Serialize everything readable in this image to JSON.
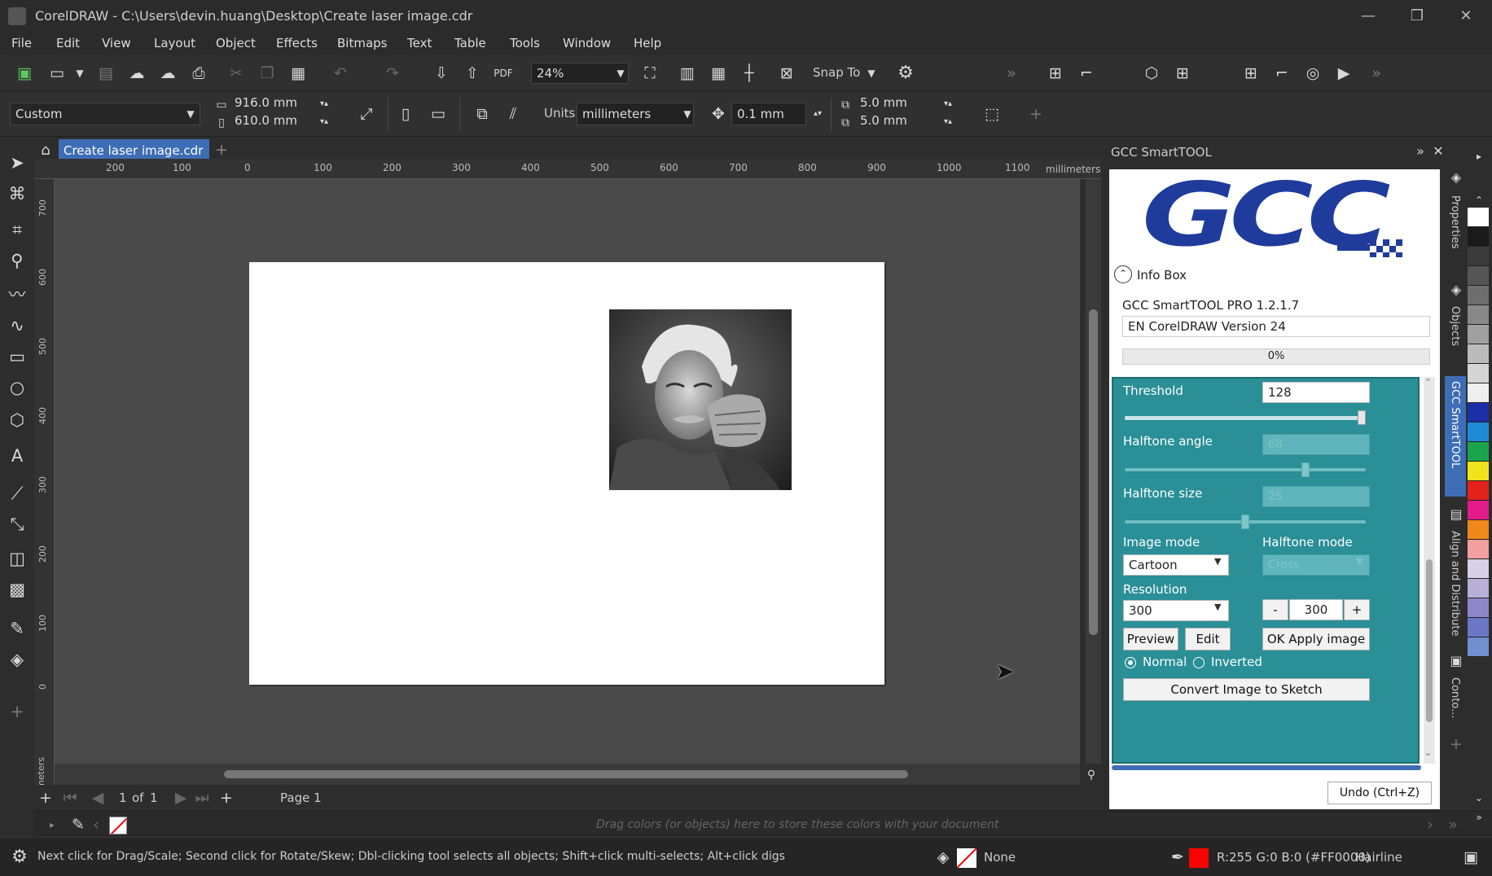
{
  "window": {
    "title": "CorelDRAW - C:\\Users\\devin.huang\\Desktop\\Create laser image.cdr",
    "minimize": "—",
    "restore": "❐",
    "close": "✕"
  },
  "menu": [
    "File",
    "Edit",
    "View",
    "Layout",
    "Object",
    "Effects",
    "Bitmaps",
    "Text",
    "Table",
    "Tools",
    "Window",
    "Help"
  ],
  "toolbar": {
    "zoom": "24%",
    "snap_to": "Snap To",
    "pdf_label": "PDF"
  },
  "property_bar": {
    "page_preset": "Custom",
    "width": "916.0 mm",
    "height": "610.0 mm",
    "units_label": "Units:",
    "units_value": "millimeters",
    "nudge": "0.1 mm",
    "dup_x": "5.0 mm",
    "dup_y": "5.0 mm"
  },
  "document_tab": {
    "name": "Create laser image.cdr"
  },
  "ruler": {
    "units": "millimeters",
    "h_ticks": [
      "200",
      "100",
      "0",
      "100",
      "200",
      "300",
      "400",
      "500",
      "600",
      "700",
      "800",
      "900",
      "1000",
      "1100"
    ],
    "v_ticks": [
      "700",
      "600",
      "500",
      "400",
      "300",
      "200",
      "100",
      "0"
    ]
  },
  "page_nav": {
    "current": "1",
    "of": "of",
    "total": "1",
    "page_tab": "Page 1"
  },
  "palette_hint": "Drag colors (or objects) here to store these colors with your document",
  "status": {
    "hint": "Next click for Drag/Scale; Second click for Rotate/Skew; Dbl-clicking tool selects all objects; Shift+click multi-selects; Alt+click digs",
    "fill": "None",
    "outline": "R:255 G:0 B:0 (#FF0000)",
    "outline_width": "Hairline"
  },
  "smarttool": {
    "panel_title": "GCC SmartTOOL",
    "logo_text": "GCC",
    "info_box": "Info Box",
    "version": "GCC SmartTOOL PRO 1.2.1.7",
    "app_version": "EN CorelDRAW Version 24",
    "progress": "0%",
    "progress_value": 0,
    "threshold_label": "Threshold",
    "threshold_value": "128",
    "threshold_level": 1.0,
    "halftone_angle_label": "Halftone angle",
    "halftone_angle_value": "68",
    "halftone_angle_level": 0.76,
    "halftone_size_label": "Halftone size",
    "halftone_size_value": "25",
    "halftone_size_level": 0.5,
    "image_mode_label": "Image mode",
    "image_mode_value": "Cartoon",
    "halftone_mode_label": "Halftone mode",
    "halftone_mode_value": "Cross",
    "resolution_label": "Resolution",
    "resolution_value": "300",
    "resolution_stepper": "300",
    "minus": "-",
    "plus": "+",
    "preview_button": "Preview",
    "edit_button": "Edit",
    "apply_button": "OK Apply image",
    "normal_label": "Normal",
    "inverted_label": "Inverted",
    "convert_button": "Convert Image to Sketch",
    "undo_button": "Undo (Ctrl+Z)"
  },
  "dockers": [
    "Properties",
    "Objects",
    "GCC SmartTOOL",
    "Align and Distribute",
    "Conto..."
  ],
  "colors": {
    "accent_blue": "#3d6db5",
    "panel_teal": "#2a8f97",
    "gcc_blue": "#1f3b9c",
    "outline_red": "#FF0000"
  },
  "palette_swatches": [
    "#ffffff",
    "#1a1a1a",
    "#3a3a3a",
    "#555555",
    "#6e6e6e",
    "#888888",
    "#a0a0a0",
    "#bbbbbb",
    "#d5d5d5",
    "#eeeeee",
    "#1b2fa8",
    "#1e8ad8",
    "#1aa44b",
    "#f0e21b",
    "#e3211b",
    "#e31a8a",
    "#f0881b",
    "#f5a0a0",
    "#d8d0e8",
    "#b8b0d8",
    "#8c88c8",
    "#6b78c8",
    "#7090d0"
  ]
}
